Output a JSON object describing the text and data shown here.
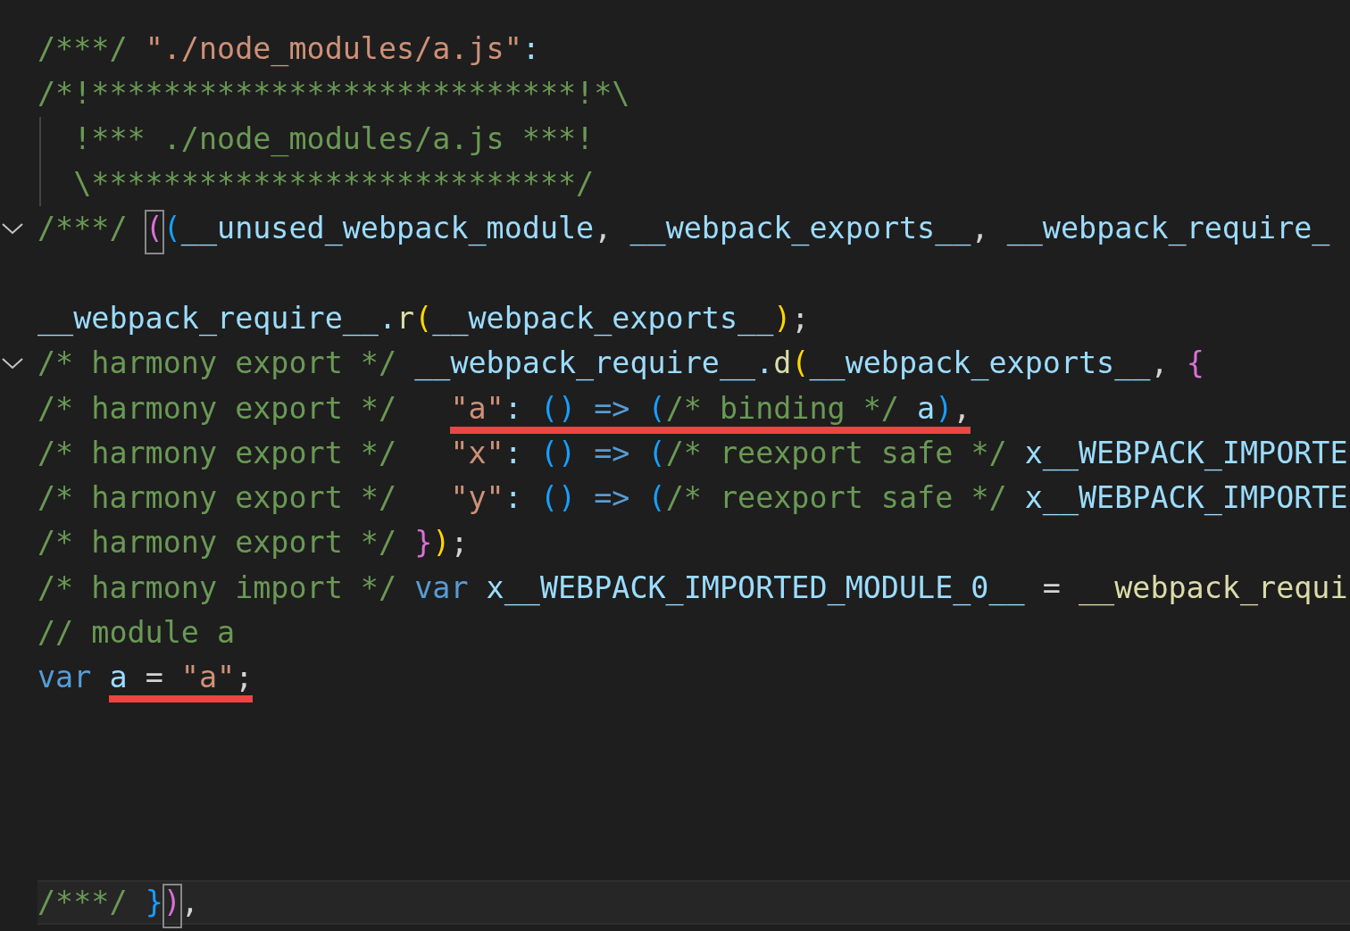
{
  "editor": {
    "lines": [
      {
        "foldable": false,
        "current": false,
        "indent_guide": false,
        "tokens": [
          {
            "text": "/***/ ",
            "kind": "comment"
          },
          {
            "text": "\"./node_modules/a.js\"",
            "kind": "string"
          },
          {
            "text": ":",
            "kind": "variable"
          }
        ]
      },
      {
        "foldable": false,
        "current": false,
        "indent_guide": false,
        "tokens": [
          {
            "text": "/*!***************************!*\\",
            "kind": "comment"
          }
        ]
      },
      {
        "foldable": false,
        "current": false,
        "indent_guide": true,
        "tokens": [
          {
            "text": "  !*** ./node_modules/a.js ***!",
            "kind": "comment"
          }
        ]
      },
      {
        "foldable": false,
        "current": false,
        "indent_guide": true,
        "tokens": [
          {
            "text": "  \\***************************/",
            "kind": "comment"
          }
        ]
      },
      {
        "foldable": true,
        "current": false,
        "indent_guide": false,
        "tokens": [
          {
            "text": "/***/ ",
            "kind": "comment"
          },
          {
            "text": "(",
            "kind": "bracket-orchid",
            "matched": true
          },
          {
            "text": "(",
            "kind": "bracket-blue"
          },
          {
            "text": "__unused_webpack_module",
            "kind": "variable"
          },
          {
            "text": ", ",
            "kind": "punct"
          },
          {
            "text": "__webpack_exports__",
            "kind": "variable"
          },
          {
            "text": ", ",
            "kind": "punct"
          },
          {
            "text": "__webpack_require_",
            "kind": "variable"
          }
        ]
      },
      {
        "foldable": false,
        "current": false,
        "indent_guide": false
      },
      {
        "foldable": false,
        "current": false,
        "indent_guide": false,
        "tokens": [
          {
            "text": "__webpack_require__.",
            "kind": "variable"
          },
          {
            "text": "r",
            "kind": "function"
          },
          {
            "text": "(",
            "kind": "bracket-gold"
          },
          {
            "text": "__webpack_exports__",
            "kind": "variable"
          },
          {
            "text": ")",
            "kind": "bracket-gold"
          },
          {
            "text": ";",
            "kind": "punct"
          }
        ]
      },
      {
        "foldable": true,
        "current": false,
        "indent_guide": false,
        "tokens": [
          {
            "text": "/* harmony export */ ",
            "kind": "comment"
          },
          {
            "text": "__webpack_require__.",
            "kind": "variable"
          },
          {
            "text": "d",
            "kind": "function"
          },
          {
            "text": "(",
            "kind": "bracket-gold"
          },
          {
            "text": "__webpack_exports__",
            "kind": "variable"
          },
          {
            "text": ", ",
            "kind": "punct"
          },
          {
            "text": "{",
            "kind": "bracket-orchid"
          }
        ]
      },
      {
        "foldable": false,
        "current": false,
        "indent_guide": false,
        "tokens": [
          {
            "text": "/* harmony export */   ",
            "kind": "comment",
            "underlined": false
          },
          {
            "text": "\"a\"",
            "kind": "string",
            "underlined": true
          },
          {
            "text": ": ",
            "kind": "variable",
            "underlined": true
          },
          {
            "text": "() ",
            "kind": "bracket-blue",
            "underlined": true
          },
          {
            "text": "=> ",
            "kind": "keyword",
            "underlined": true
          },
          {
            "text": "(",
            "kind": "bracket-blue",
            "underlined": true
          },
          {
            "text": "/* binding */",
            "kind": "comment",
            "underlined": true
          },
          {
            "text": " a",
            "kind": "variable",
            "underlined": true
          },
          {
            "text": ")",
            "kind": "bracket-blue",
            "underlined": true
          },
          {
            "text": ",",
            "kind": "punct",
            "underlined": true
          }
        ]
      },
      {
        "foldable": false,
        "current": false,
        "indent_guide": false,
        "tokens": [
          {
            "text": "/* harmony export */   ",
            "kind": "comment"
          },
          {
            "text": "\"x\"",
            "kind": "string"
          },
          {
            "text": ": ",
            "kind": "variable"
          },
          {
            "text": "() ",
            "kind": "bracket-blue"
          },
          {
            "text": "=> ",
            "kind": "keyword"
          },
          {
            "text": "(",
            "kind": "bracket-blue"
          },
          {
            "text": "/* reexport safe */",
            "kind": "comment"
          },
          {
            "text": " x__WEBPACK_IMPORTE",
            "kind": "variable"
          }
        ]
      },
      {
        "foldable": false,
        "current": false,
        "indent_guide": false,
        "tokens": [
          {
            "text": "/* harmony export */   ",
            "kind": "comment"
          },
          {
            "text": "\"y\"",
            "kind": "string"
          },
          {
            "text": ": ",
            "kind": "variable"
          },
          {
            "text": "() ",
            "kind": "bracket-blue"
          },
          {
            "text": "=> ",
            "kind": "keyword"
          },
          {
            "text": "(",
            "kind": "bracket-blue"
          },
          {
            "text": "/* reexport safe */",
            "kind": "comment"
          },
          {
            "text": " x__WEBPACK_IMPORTE",
            "kind": "variable"
          }
        ]
      },
      {
        "foldable": false,
        "current": false,
        "indent_guide": false,
        "tokens": [
          {
            "text": "/* harmony export */ ",
            "kind": "comment"
          },
          {
            "text": "}",
            "kind": "bracket-orchid"
          },
          {
            "text": ")",
            "kind": "bracket-gold"
          },
          {
            "text": ";",
            "kind": "punct"
          }
        ]
      },
      {
        "foldable": false,
        "current": false,
        "indent_guide": false,
        "tokens": [
          {
            "text": "/* harmony import */ ",
            "kind": "comment"
          },
          {
            "text": "var",
            "kind": "keyword"
          },
          {
            "text": " x__WEBPACK_IMPORTED_MODULE_0__",
            "kind": "variable"
          },
          {
            "text": " = ",
            "kind": "punct"
          },
          {
            "text": "__webpack_requi",
            "kind": "function"
          }
        ]
      },
      {
        "foldable": false,
        "current": false,
        "indent_guide": false,
        "tokens": [
          {
            "text": "// module a",
            "kind": "comment"
          }
        ]
      },
      {
        "foldable": false,
        "current": false,
        "indent_guide": false,
        "tokens": [
          {
            "text": "var ",
            "kind": "keyword",
            "underlined": false
          },
          {
            "text": "a",
            "kind": "variable",
            "underlined": true
          },
          {
            "text": " = ",
            "kind": "punct",
            "underlined": true
          },
          {
            "text": "\"a\"",
            "kind": "string",
            "underlined": true
          },
          {
            "text": ";",
            "kind": "punct",
            "underlined": true
          }
        ]
      },
      {
        "foldable": false,
        "current": false,
        "indent_guide": false
      },
      {
        "foldable": false,
        "current": false,
        "indent_guide": false
      },
      {
        "foldable": false,
        "current": false,
        "indent_guide": false
      },
      {
        "foldable": false,
        "current": false,
        "indent_guide": false
      },
      {
        "foldable": false,
        "current": true,
        "indent_guide": false,
        "tokens": [
          {
            "text": "/***/ ",
            "kind": "comment"
          },
          {
            "text": "}",
            "kind": "bracket-blue"
          },
          {
            "text": ")",
            "kind": "bracket-orchid",
            "matched": true
          },
          {
            "text": ",",
            "kind": "punct"
          }
        ]
      }
    ]
  }
}
